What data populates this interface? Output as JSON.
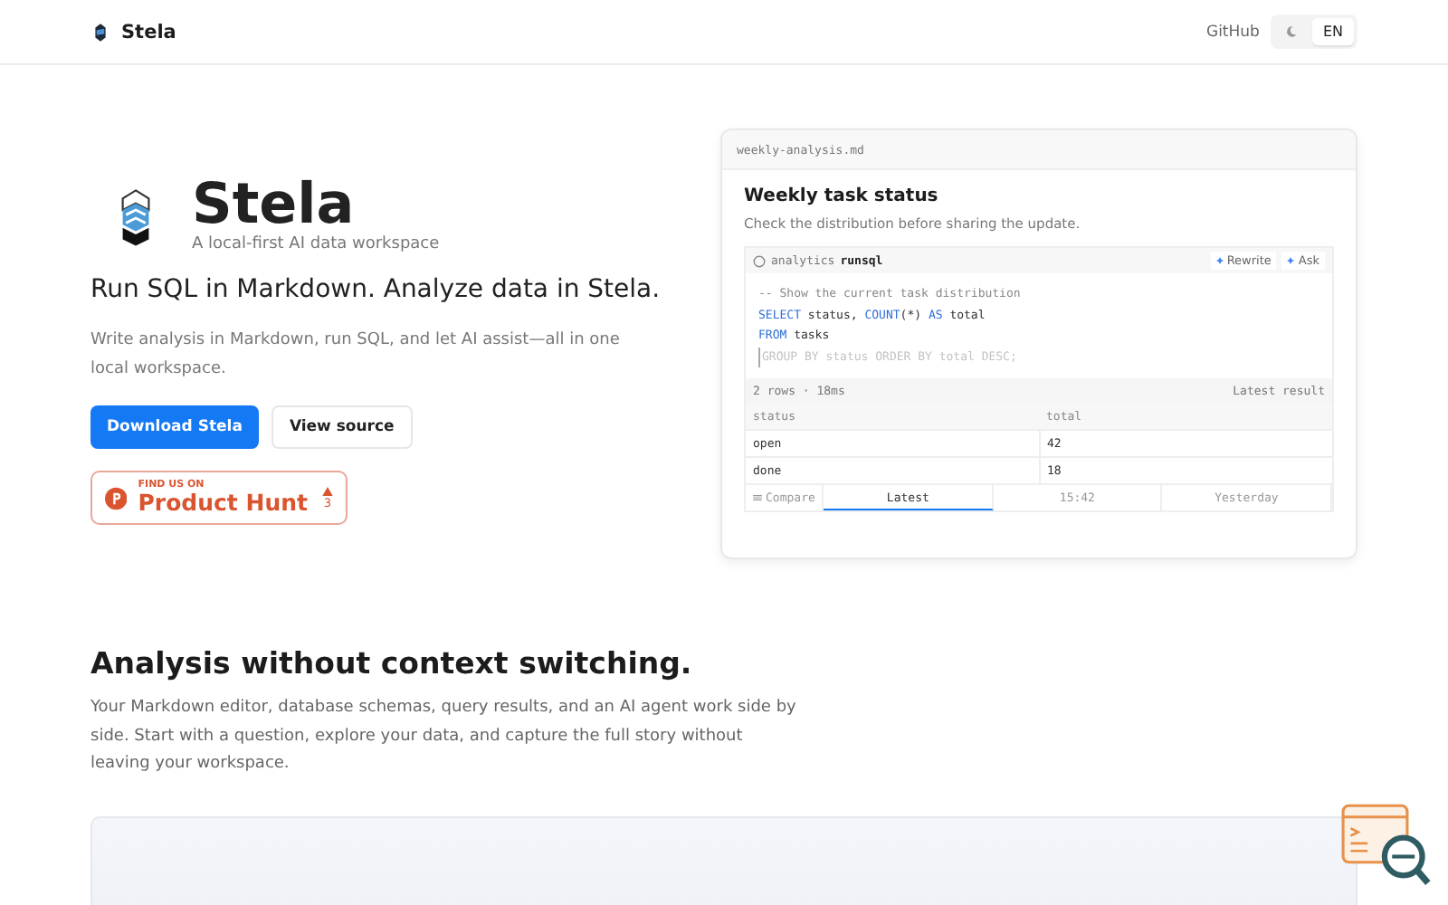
{
  "header": {
    "brand": "Stela",
    "github": "GitHub",
    "language_options": [
      {
        "label": "EN",
        "selected": true
      }
    ]
  },
  "hero": {
    "title": "Stela",
    "tagline": "A local-first AI data workspace",
    "headline": "Run SQL in Markdown. Analyze data in Stela.",
    "description": "Write analysis in Markdown, run SQL, and let AI assist—all in one local workspace.",
    "buttons": [
      {
        "label": "Download Stela",
        "kind": "primary"
      },
      {
        "label": "View source",
        "kind": "secondary"
      }
    ],
    "badge": {
      "eyebrow": "FIND US ON",
      "name": "Product Hunt",
      "count": "3"
    }
  },
  "preview": {
    "filename": "weekly-analysis.md",
    "title": "Weekly task status",
    "subtitle": "Check the distribution before sharing the update.",
    "cell": {
      "source": "analytics",
      "language": "runsql",
      "actions": [
        "Rewrite",
        "Ask"
      ],
      "code": [
        {
          "kind": "comment",
          "text": "-- Show the current task distribution"
        },
        {
          "kind": "sql",
          "parts": [
            {
              "t": "SELECT",
              "kw": true
            },
            {
              "t": " status, ",
              "kw": false
            },
            {
              "t": "COUNT",
              "kw": true
            },
            {
              "t": "(*) ",
              "kw": false
            },
            {
              "t": "AS",
              "kw": true
            },
            {
              "t": " total",
              "kw": false
            }
          ]
        },
        {
          "kind": "sql",
          "parts": [
            {
              "t": "FROM",
              "kw": true
            },
            {
              "t": " tasks",
              "kw": false
            }
          ]
        },
        {
          "kind": "ghost",
          "text": "GROUP BY status ORDER BY total DESC;"
        }
      ]
    },
    "result": {
      "meta": "2 rows · 18ms",
      "label": "Latest result",
      "columns": [
        "status",
        "total"
      ],
      "rows": [
        [
          "open",
          "42"
        ],
        [
          "done",
          "18"
        ]
      ]
    },
    "compare": {
      "label": "Compare",
      "tabs": [
        {
          "label": "Latest",
          "selected": true
        },
        {
          "label": "15:42",
          "selected": false
        },
        {
          "label": "Yesterday",
          "selected": false
        }
      ]
    }
  },
  "section": {
    "heading": "Analysis without context switching.",
    "body": "Your Markdown editor, database schemas, query results, and an AI agent work side by side. Start with a question, explore your data, and capture the full story without leaving your workspace."
  }
}
